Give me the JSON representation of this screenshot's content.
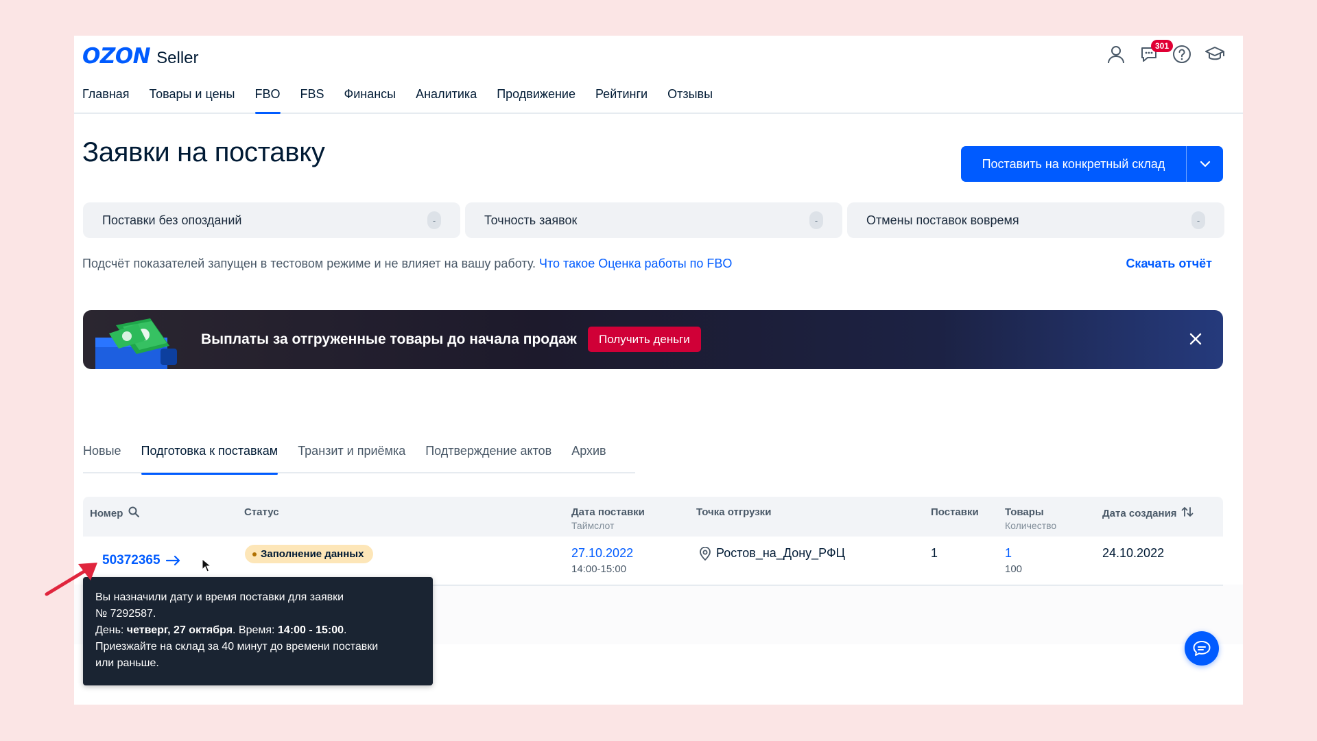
{
  "brand": {
    "logo_main": "OZON",
    "logo_sub": "Seller"
  },
  "header": {
    "notifications_count": "301",
    "nav": [
      "Главная",
      "Товары и цены",
      "FBO",
      "FBS",
      "Финансы",
      "Аналитика",
      "Продвижение",
      "Рейтинги",
      "Отзывы"
    ],
    "nav_active": "FBO"
  },
  "page": {
    "title": "Заявки на поставку",
    "primary_button": "Поставить на конкретный склад"
  },
  "metrics": [
    {
      "label": "Поставки без опозданий",
      "value": "-"
    },
    {
      "label": "Точность заявок",
      "value": "-"
    },
    {
      "label": "Отмены поставок вовремя",
      "value": "-"
    }
  ],
  "notice": {
    "text": "Подсчёт показателей запущен в тестовом режиме и не влияет на вашу работу.",
    "link": "Что такое Оценка работы по FBO",
    "download": "Скачать отчёт"
  },
  "promo": {
    "text": "Выплаты за отгруженные товары до начала продаж",
    "button": "Получить деньги"
  },
  "tabs": [
    "Новые",
    "Подготовка к поставкам",
    "Транзит и приёмка",
    "Подтверждение актов",
    "Архив"
  ],
  "tabs_active": "Подготовка к поставкам",
  "table": {
    "headers": {
      "number": "Номер",
      "status": "Статус",
      "delivery_date": "Дата поставки",
      "delivery_date_sub": "Таймслот",
      "point": "Точка отгрузки",
      "supplies": "Поставки",
      "goods": "Товары",
      "goods_sub": "Количество",
      "created": "Дата создания"
    },
    "rows": [
      {
        "number": "50372365",
        "status": "Заполнение данных",
        "date": "27.10.2022",
        "slot": "14:00-15:00",
        "point": "Ростов_на_Дону_РФЦ",
        "supplies": "1",
        "goods": "1",
        "quantity": "100",
        "created": "24.10.2022"
      }
    ]
  },
  "tooltip": {
    "line1": "Вы назначили дату и время поставки для заявки",
    "line2": "№ 7292587.",
    "day_label": "День: ",
    "day_value": "четверг, 27 октября",
    "time_label": ". Время: ",
    "time_value": "14:00 - 15:00",
    "time_end": ".",
    "line4": "Приезжайте на склад за 40 минут до времени поставки",
    "line5": "или раньше."
  },
  "colors": {
    "accent": "#005bff",
    "promo_button": "#d00037",
    "status_badge": "#fde6b8",
    "annotation_arrow": "#e0253d"
  }
}
